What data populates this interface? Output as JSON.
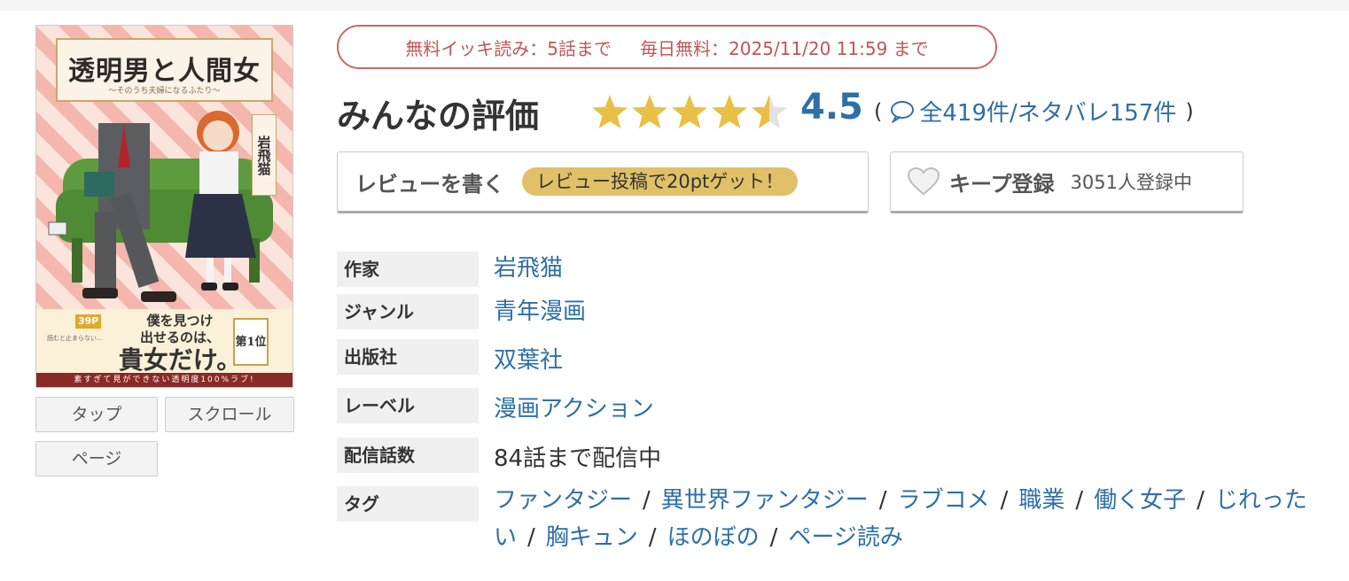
{
  "cover": {
    "title": "透明男と人間女",
    "subtitle": "〜そのうち夫婦になるふたり〜",
    "author": "岩飛猫",
    "band_badge": "39P",
    "band_small": "読むと止まらない…",
    "band_line1": "僕を見つけ",
    "band_line2": "出せるのは、",
    "band_line3": "貴女だけ。",
    "band_rank": "第1位",
    "footer": "素すぎて見ができない透明度100%ラブ!"
  },
  "view_modes": {
    "tap": "タップ",
    "scroll": "スクロール",
    "page": "ページ"
  },
  "free": {
    "ikki": "無料イッキ読み：5話まで",
    "daily": "毎日無料：2025/11/20 11:59 まで"
  },
  "rating": {
    "title": "みんなの評価",
    "stars": 4.5,
    "score": "4.5",
    "open_paren": "(",
    "counts": "全419件/ネタバレ157件",
    "close_paren": ")"
  },
  "buttons": {
    "review": "レビューを書く",
    "review_badge": "レビュー投稿で20ptゲット！",
    "keep": "キープ登録",
    "keep_count": "3051人登録中"
  },
  "info": {
    "author_label": "作家",
    "author": "岩飛猫",
    "genre_label": "ジャンル",
    "genre": "青年漫画",
    "publisher_label": "出版社",
    "publisher": "双葉社",
    "label_label": "レーベル",
    "label": "漫画アクション",
    "episodes_label": "配信話数",
    "episodes": "84話まで配信中",
    "tags_label": "タグ",
    "tags": [
      "ファンタジー",
      "異世界ファンタジー",
      "ラブコメ",
      "職業",
      "働く女子",
      "じれったい",
      "胸キュン",
      "ほのぼの",
      "ページ読み"
    ]
  },
  "colors": {
    "link": "#2e6fa7",
    "star": "#e9c046",
    "free_text": "#c05656",
    "badge_bg": "#e1c167"
  }
}
